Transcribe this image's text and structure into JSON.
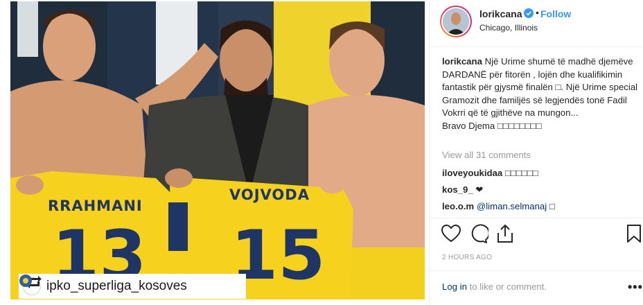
{
  "photo": {
    "jersey_left_name": "RRAHMANI",
    "jersey_left_number": "13",
    "jersey_right_name": "VOJVODA",
    "jersey_right_number": "15",
    "repost_handle": "ipko_superliga_kosoves",
    "icons": {
      "repost": "repost-icon",
      "logo": "league-logo"
    },
    "colors": {
      "jersey": "#f6d21e",
      "jersey_text": "#1e3566",
      "background": "#3b4a5c"
    }
  },
  "header": {
    "username": "lorikcana",
    "separator": "•",
    "follow_label": "Follow",
    "location": "Chicago, Illinois",
    "colors": {
      "follow": "#3897f0",
      "verified": "#3897f0"
    }
  },
  "caption": {
    "username": "lorikcana",
    "text": "Një Urime shumë të madhë djemëve DARDANË për fitorën , lojën dhe kualifikimin fantastik për gjysmë finalën □. Një Urime special Gramozit dhe familjës së legjendës tonë Fadil Vokrri që të gjithëve na mungon...",
    "line_last": "Bravo Djema □□□□□□□□"
  },
  "comments": {
    "view_all": "View all 31 comments",
    "items": [
      {
        "user": "iloveyoukidaa",
        "text": " □□□□□□",
        "mention": ""
      },
      {
        "user": "kos_9_",
        "text": " ❤",
        "mention": ""
      },
      {
        "user": "leo.o.m",
        "text": " □",
        "mention": "@liman.selmanaj"
      }
    ]
  },
  "actions": {
    "like": "heart-icon",
    "comment": "comment-icon",
    "share": "share-icon",
    "save": "bookmark-icon"
  },
  "timestamp": "2 HOURS AGO",
  "footer": {
    "login_link": "Log in",
    "login_rest": " to like or comment.",
    "more": "•••"
  }
}
